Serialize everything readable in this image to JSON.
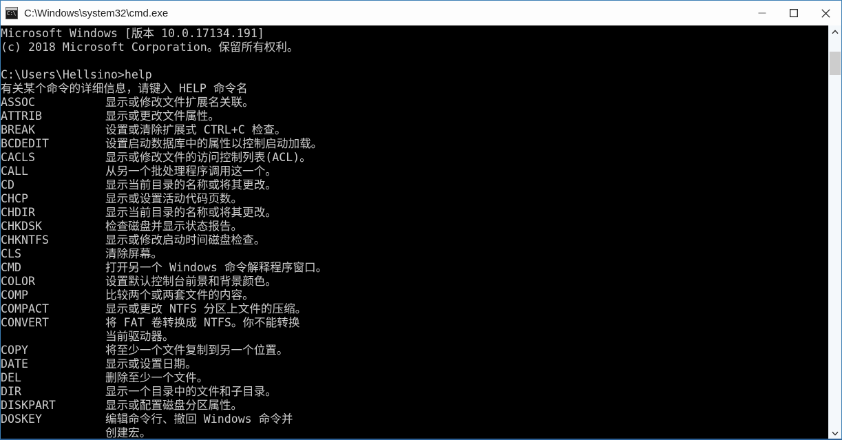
{
  "window": {
    "title": "C:\\Windows\\system32\\cmd.exe",
    "icon": "cmd-console-icon",
    "icon_glyph": "C:\\",
    "accent_border_color": "#3c7eb4",
    "titlebar_background": "#fdfdfd",
    "console_background": "#000000",
    "console_foreground": "#cccccc"
  },
  "controls": {
    "minimize_label": "Minimize",
    "maximize_label": "Maximize",
    "close_label": "Close"
  },
  "scrollbar": {
    "up_arrow_label": "Scroll up",
    "down_arrow_label": "Scroll down",
    "thumb_label": "Scroll thumb",
    "position_percent": 2
  },
  "console": {
    "header_lines": [
      "Microsoft Windows [版本 10.0.17134.191]",
      "(c) 2018 Microsoft Corporation。保留所有权利。",
      "",
      "C:\\Users\\Hellsino>help",
      "有关某个命令的详细信息，请键入 HELP 命令名"
    ],
    "prompt": "C:\\Users\\Hellsino>",
    "command": "help",
    "help_intro": "有关某个命令的详细信息，请键入 HELP 命令名",
    "commands": [
      {
        "name": "ASSOC",
        "desc": "显示或修改文件扩展名关联。"
      },
      {
        "name": "ATTRIB",
        "desc": "显示或更改文件属性。"
      },
      {
        "name": "BREAK",
        "desc": "设置或清除扩展式 CTRL+C 检查。"
      },
      {
        "name": "BCDEDIT",
        "desc": "设置启动数据库中的属性以控制启动加载。"
      },
      {
        "name": "CACLS",
        "desc": "显示或修改文件的访问控制列表(ACL)。"
      },
      {
        "name": "CALL",
        "desc": "从另一个批处理程序调用这一个。"
      },
      {
        "name": "CD",
        "desc": "显示当前目录的名称或将其更改。"
      },
      {
        "name": "CHCP",
        "desc": "显示或设置活动代码页数。"
      },
      {
        "name": "CHDIR",
        "desc": "显示当前目录的名称或将其更改。"
      },
      {
        "name": "CHKDSK",
        "desc": "检查磁盘并显示状态报告。"
      },
      {
        "name": "CHKNTFS",
        "desc": "显示或修改启动时间磁盘检查。"
      },
      {
        "name": "CLS",
        "desc": "清除屏幕。"
      },
      {
        "name": "CMD",
        "desc": "打开另一个 Windows 命令解释程序窗口。"
      },
      {
        "name": "COLOR",
        "desc": "设置默认控制台前景和背景颜色。"
      },
      {
        "name": "COMP",
        "desc": "比较两个或两套文件的内容。"
      },
      {
        "name": "COMPACT",
        "desc": "显示或更改 NTFS 分区上文件的压缩。"
      },
      {
        "name": "CONVERT",
        "desc": "将 FAT 卷转换成 NTFS。你不能转换"
      },
      {
        "name": "",
        "desc": "当前驱动器。"
      },
      {
        "name": "COPY",
        "desc": "将至少一个文件复制到另一个位置。"
      },
      {
        "name": "DATE",
        "desc": "显示或设置日期。"
      },
      {
        "name": "DEL",
        "desc": "删除至少一个文件。"
      },
      {
        "name": "DIR",
        "desc": "显示一个目录中的文件和子目录。"
      },
      {
        "name": "DISKPART",
        "desc": "显示或配置磁盘分区属性。"
      },
      {
        "name": "DOSKEY",
        "desc": "编辑命令行、撤回 Windows 命令并"
      },
      {
        "name": "",
        "desc": "创建宏。"
      }
    ]
  }
}
